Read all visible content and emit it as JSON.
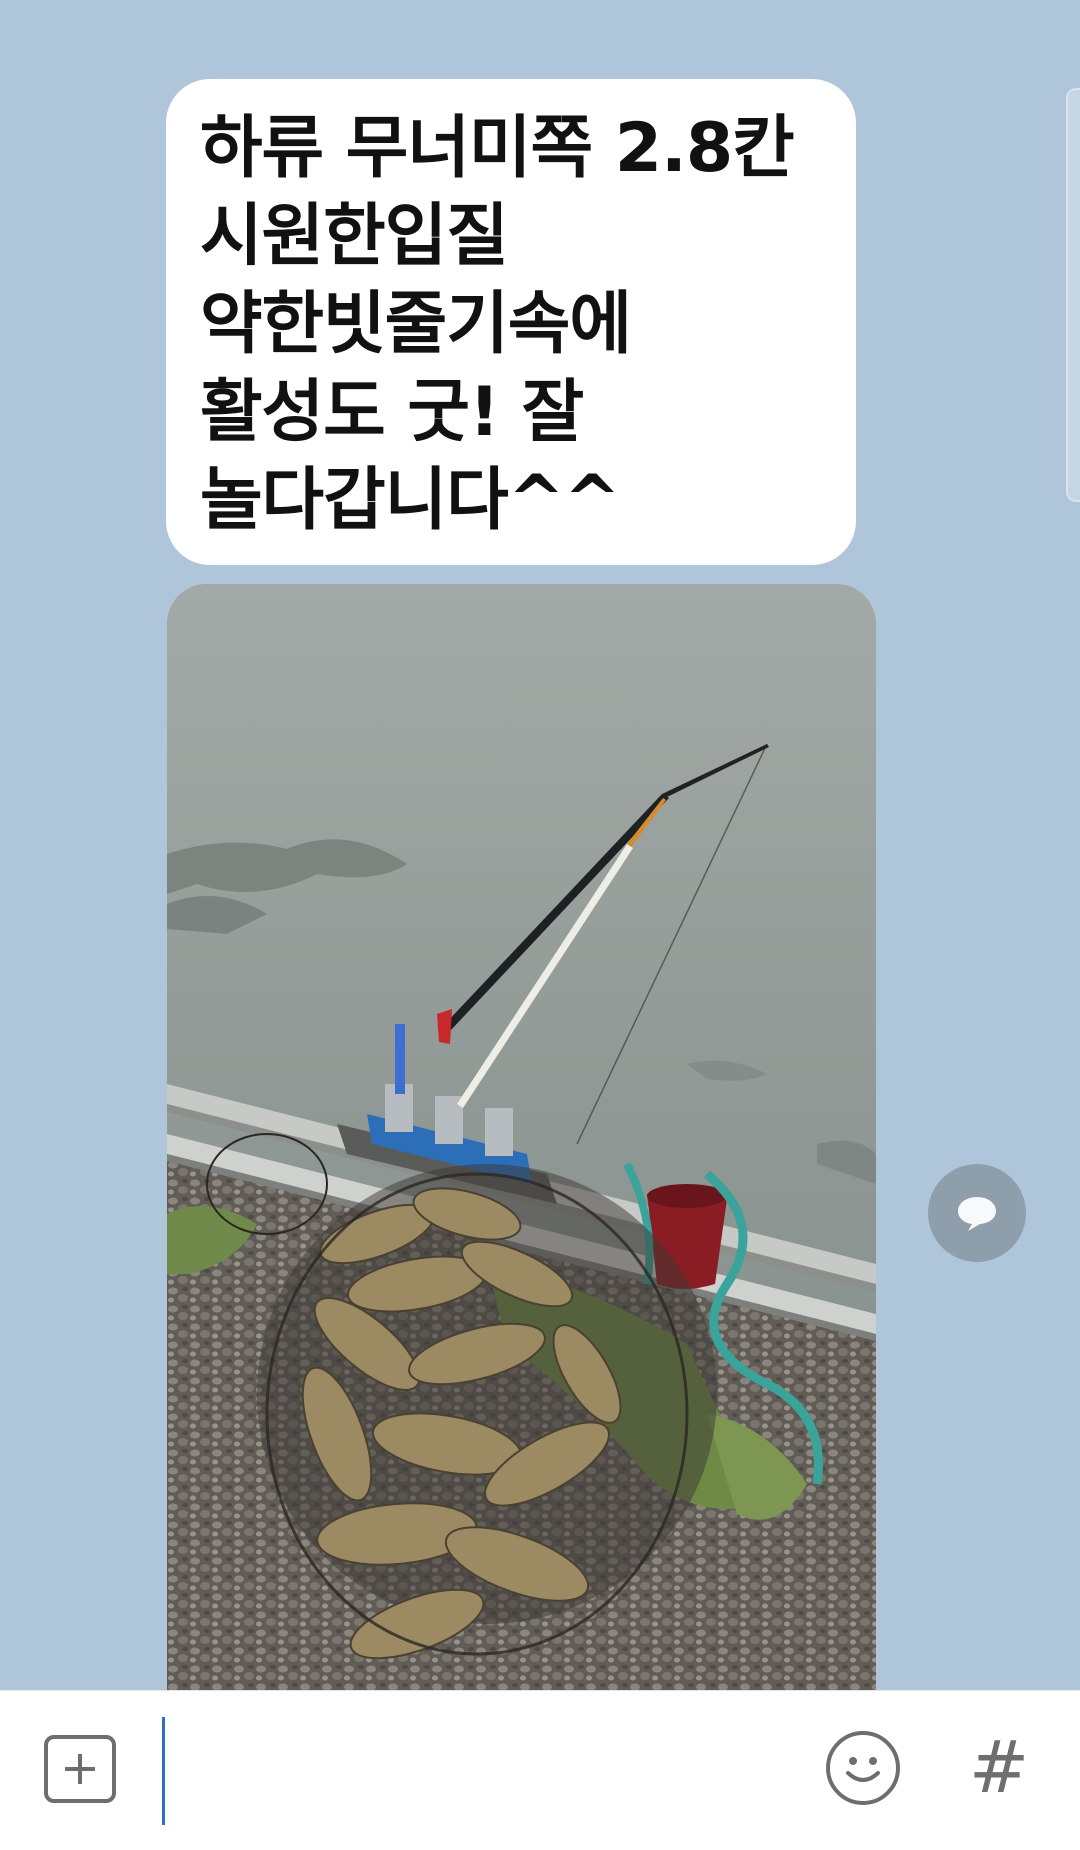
{
  "message": {
    "text": "하류 무너미쪽 2.8칸\n시원한입질\n약한빗줄기속에\n활성도 굿! 잘\n놀다갑니다^^"
  },
  "photo": {
    "subject": "fishing-rod-and-catch-photo"
  },
  "icons": {
    "reply": "speech-bubble-icon",
    "add": "plus-box-icon",
    "emoji": "smiley-icon",
    "hashtag": "hash-icon"
  },
  "input": {
    "value": "",
    "hashtag_label": "#"
  },
  "colors": {
    "chat_background": "#afc5d9",
    "bubble": "#ffffff",
    "cursor": "#2d6fc2",
    "icon_gray": "#6e6e6e"
  }
}
